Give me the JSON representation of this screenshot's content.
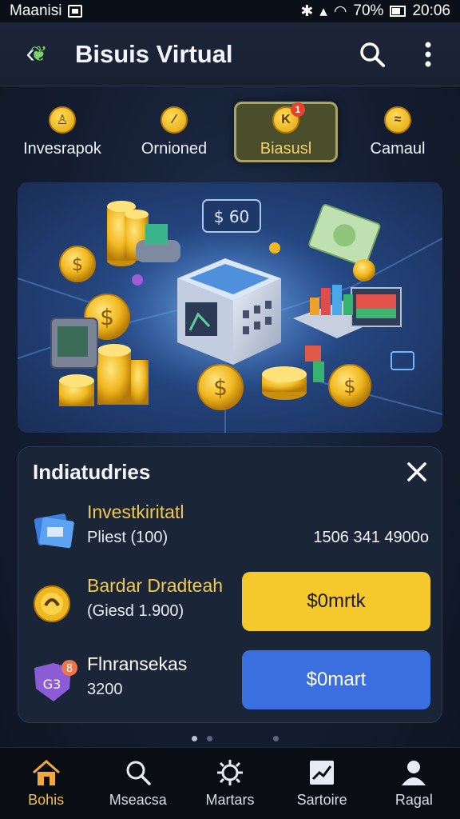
{
  "status": {
    "carrier": "Maanisi",
    "battery": "70%",
    "time": "20:06"
  },
  "appbar": {
    "title": "Bisuis Virtual"
  },
  "categories": [
    {
      "label": "Invesrapok",
      "icon": "coin-person-icon"
    },
    {
      "label": "Ornioned",
      "icon": "coin-slash-icon"
    },
    {
      "label": "Biasusl",
      "icon": "coin-k-icon",
      "badge": "1"
    },
    {
      "label": "Camaul",
      "icon": "coin-wave-icon"
    }
  ],
  "banner": {
    "price_tag": "$ 60"
  },
  "card": {
    "title": "Indiatudries",
    "items": [
      {
        "name": "Investkiritatl",
        "sub": "Pliest (100)",
        "value": "1506 341 4900o",
        "name_color": "#f2c94c"
      },
      {
        "name": "Bardar Dradteah",
        "sub": "(Giesd 1.900)",
        "button": "$0mrtk",
        "name_color": "#f2c94c"
      },
      {
        "name": "Flnransekas",
        "sub": "3200",
        "button": "$0mart",
        "badge": "8",
        "name_color": "#ffffff"
      }
    ]
  },
  "bottom_nav": [
    {
      "label": "Bohis",
      "icon": "home-icon",
      "active": true
    },
    {
      "label": "Mseacsa",
      "icon": "search-icon",
      "active": false
    },
    {
      "label": "Martars",
      "icon": "gear-icon",
      "active": false
    },
    {
      "label": "Sartoire",
      "icon": "chart-icon",
      "active": false
    },
    {
      "label": "Ragal",
      "icon": "person-icon",
      "active": false
    }
  ],
  "colors": {
    "accent": "#f5c82c",
    "blue_button": "#3b6fe0",
    "card_bg": "#1b2538"
  }
}
